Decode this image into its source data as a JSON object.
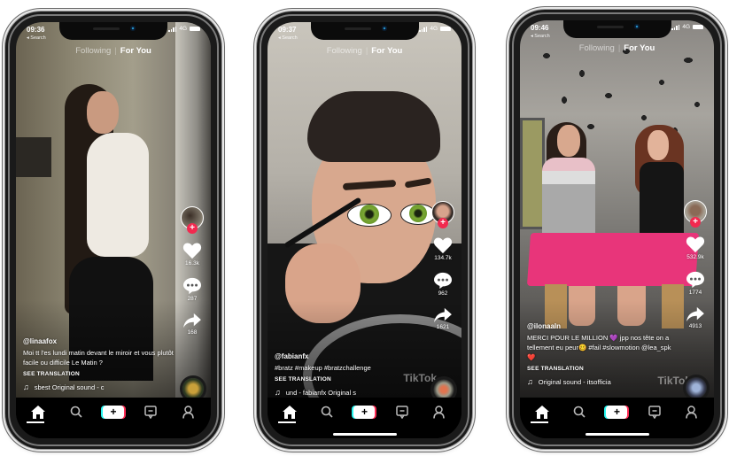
{
  "feed_tabs": {
    "following": "Following",
    "separator": "|",
    "for_you": "For You"
  },
  "nav": {
    "items": [
      "home",
      "discover",
      "create",
      "inbox",
      "profile"
    ],
    "icons": {
      "home": "home-icon",
      "discover": "search-icon",
      "create": "plus-icon",
      "inbox": "inbox-icon",
      "profile": "profile-icon"
    },
    "plus_glyph": "+",
    "active": "home"
  },
  "colors": {
    "accent_red": "#fe2c55",
    "accent_cyan": "#25f4ee",
    "follow_badge": "#f2294f",
    "bar_bg": "#000000"
  },
  "phones": [
    {
      "status": {
        "time": "09:36",
        "back": "◂ Search",
        "network": "4G"
      },
      "rail": {
        "follow": "+",
        "likes": "16.3k",
        "comments": "287",
        "shares": "168"
      },
      "caption": {
        "user": "@linaafox",
        "text": "Moi tt l'es lundi matin devant le miroir et vous plutôt facile  ou difficile Le Matin  ?",
        "see_translation": "SEE TRANSLATION",
        "sound": "♫",
        "sound_text": "sbest    Original sound - c"
      },
      "home_indicator": false
    },
    {
      "status": {
        "time": "09:37",
        "back": "◂ Search",
        "network": "4G"
      },
      "rail": {
        "follow": "+",
        "likes": "134.7k",
        "comments": "962",
        "shares": "1621"
      },
      "caption": {
        "user": "@fabianfx",
        "text": "#bratz #makeup #bratzchallenge",
        "see_translation": "SEE TRANSLATION",
        "sound": "♫",
        "sound_text": "und - fabianfx    Original s"
      },
      "watermark": "TikTok",
      "home_indicator": true
    },
    {
      "status": {
        "time": "09:46",
        "back": "◂ Search",
        "network": "4G"
      },
      "rail": {
        "follow": "+",
        "likes": "532.9k",
        "comments": "1774",
        "shares": "4913"
      },
      "caption": {
        "user": "@ilonaaln",
        "text": "MERCI POUR LE MILLION 💜 jpp nos tête on a tellement eu peur🥴 #fail #slowmotion @lea_spk ❤️",
        "see_translation": "SEE TRANSLATION",
        "sound": "♫",
        "sound_text": "Original sound - itsofficia"
      },
      "watermark": "TikTok",
      "home_indicator": true
    }
  ]
}
